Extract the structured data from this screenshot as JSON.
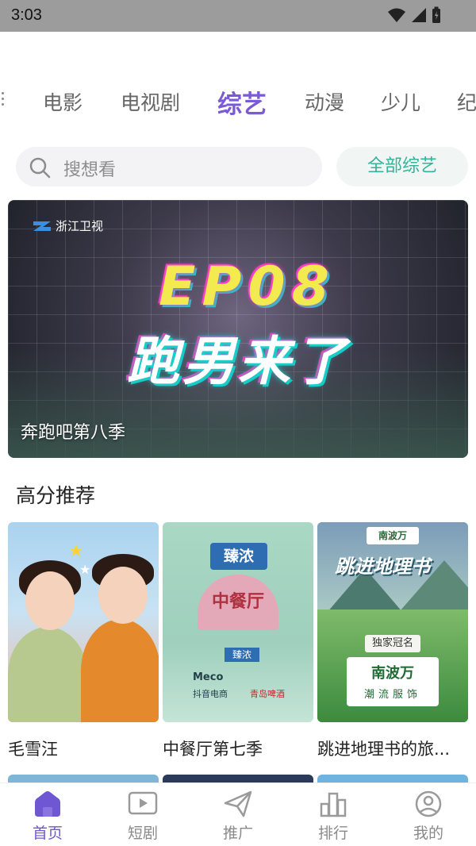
{
  "status_bar": {
    "time": "3:03"
  },
  "categories": [
    "电影",
    "电视剧",
    "综艺",
    "动漫",
    "少儿",
    "纪"
  ],
  "active_category": "综艺",
  "search": {
    "placeholder": "搜想看",
    "all_button": "全部综艺"
  },
  "banner": {
    "channel": "浙江卫视",
    "headline_ep": "EP08",
    "headline": "跑男来了",
    "caption": "奔跑吧第八季"
  },
  "section": {
    "title": "高分推荐",
    "items": [
      {
        "title": "毛雪汪"
      },
      {
        "title": "中餐厅第七季",
        "poster": {
          "brand": "臻浓",
          "show": "中餐厅",
          "sponsor": "臻浓",
          "partner1": "Meco",
          "partner2": "抖音电商",
          "partner3": "青岛啤酒"
        }
      },
      {
        "title": "跳进地理书的旅...",
        "poster": {
          "tag": "南波万",
          "headline": "跳进地理书",
          "exclusive": "独家冠名",
          "brand": "南波万",
          "slogan": "潮流服饰"
        }
      }
    ]
  },
  "bottom_nav": [
    {
      "label": "首页",
      "icon": "home-icon",
      "active": true
    },
    {
      "label": "短剧",
      "icon": "play-icon",
      "active": false
    },
    {
      "label": "推广",
      "icon": "send-icon",
      "active": false
    },
    {
      "label": "排行",
      "icon": "chart-icon",
      "active": false
    },
    {
      "label": "我的",
      "icon": "user-icon",
      "active": false
    }
  ],
  "colors": {
    "accent": "#6f56d3",
    "teal": "#33b39a"
  }
}
